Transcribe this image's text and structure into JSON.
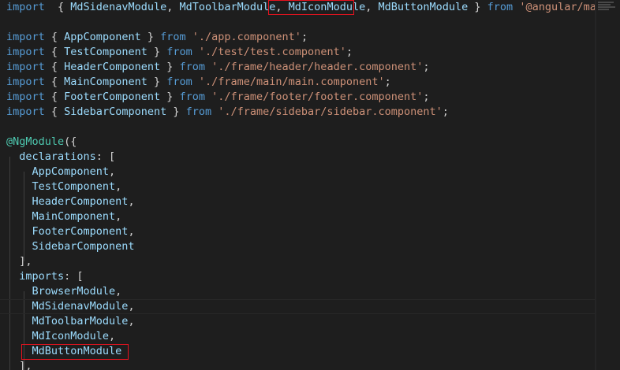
{
  "editor": {
    "lines": [
      {
        "tokens": [
          {
            "t": "import",
            "c": "kw"
          },
          {
            "t": "  { ",
            "c": "punc"
          },
          {
            "t": "MdSidenavModule",
            "c": "ident"
          },
          {
            "t": ", ",
            "c": "punc"
          },
          {
            "t": "MdToolbarModule",
            "c": "ident"
          },
          {
            "t": ", ",
            "c": "punc"
          },
          {
            "t": "MdIconModule",
            "c": "ident"
          },
          {
            "t": ", ",
            "c": "punc"
          },
          {
            "t": "MdButtonModule",
            "c": "ident"
          },
          {
            "t": " } ",
            "c": "punc"
          },
          {
            "t": "from",
            "c": "kw"
          },
          {
            "t": " ",
            "c": "punc"
          },
          {
            "t": "'@angular/materia",
            "c": "str"
          }
        ]
      },
      {
        "tokens": []
      },
      {
        "tokens": [
          {
            "t": "import",
            "c": "kw"
          },
          {
            "t": " { ",
            "c": "punc"
          },
          {
            "t": "AppComponent",
            "c": "ident"
          },
          {
            "t": " } ",
            "c": "punc"
          },
          {
            "t": "from",
            "c": "kw"
          },
          {
            "t": " ",
            "c": "punc"
          },
          {
            "t": "'./app.component'",
            "c": "str"
          },
          {
            "t": ";",
            "c": "punc"
          }
        ]
      },
      {
        "tokens": [
          {
            "t": "import",
            "c": "kw"
          },
          {
            "t": " { ",
            "c": "punc"
          },
          {
            "t": "TestComponent",
            "c": "ident"
          },
          {
            "t": " } ",
            "c": "punc"
          },
          {
            "t": "from",
            "c": "kw"
          },
          {
            "t": " ",
            "c": "punc"
          },
          {
            "t": "'./test/test.component'",
            "c": "str"
          },
          {
            "t": ";",
            "c": "punc"
          }
        ]
      },
      {
        "tokens": [
          {
            "t": "import",
            "c": "kw"
          },
          {
            "t": " { ",
            "c": "punc"
          },
          {
            "t": "HeaderComponent",
            "c": "ident"
          },
          {
            "t": " } ",
            "c": "punc"
          },
          {
            "t": "from",
            "c": "kw"
          },
          {
            "t": " ",
            "c": "punc"
          },
          {
            "t": "'./frame/header/header.component'",
            "c": "str"
          },
          {
            "t": ";",
            "c": "punc"
          }
        ]
      },
      {
        "tokens": [
          {
            "t": "import",
            "c": "kw"
          },
          {
            "t": " { ",
            "c": "punc"
          },
          {
            "t": "MainComponent",
            "c": "ident"
          },
          {
            "t": " } ",
            "c": "punc"
          },
          {
            "t": "from",
            "c": "kw"
          },
          {
            "t": " ",
            "c": "punc"
          },
          {
            "t": "'./frame/main/main.component'",
            "c": "str"
          },
          {
            "t": ";",
            "c": "punc"
          }
        ]
      },
      {
        "tokens": [
          {
            "t": "import",
            "c": "kw"
          },
          {
            "t": " { ",
            "c": "punc"
          },
          {
            "t": "FooterComponent",
            "c": "ident"
          },
          {
            "t": " } ",
            "c": "punc"
          },
          {
            "t": "from",
            "c": "kw"
          },
          {
            "t": " ",
            "c": "punc"
          },
          {
            "t": "'./frame/footer/footer.component'",
            "c": "str"
          },
          {
            "t": ";",
            "c": "punc"
          }
        ]
      },
      {
        "tokens": [
          {
            "t": "import",
            "c": "kw"
          },
          {
            "t": " { ",
            "c": "punc"
          },
          {
            "t": "SidebarComponent",
            "c": "ident"
          },
          {
            "t": " } ",
            "c": "punc"
          },
          {
            "t": "from",
            "c": "kw"
          },
          {
            "t": " ",
            "c": "punc"
          },
          {
            "t": "'./frame/sidebar/sidebar.component'",
            "c": "str"
          },
          {
            "t": ";",
            "c": "punc"
          }
        ]
      },
      {
        "tokens": []
      },
      {
        "tokens": [
          {
            "t": "@NgModule",
            "c": "deco"
          },
          {
            "t": "({",
            "c": "punc"
          }
        ]
      },
      {
        "tokens": [
          {
            "t": "  declarations",
            "c": "ident"
          },
          {
            "t": ": [",
            "c": "punc"
          }
        ]
      },
      {
        "tokens": [
          {
            "t": "    AppComponent",
            "c": "ident"
          },
          {
            "t": ",",
            "c": "punc"
          }
        ]
      },
      {
        "tokens": [
          {
            "t": "    TestComponent",
            "c": "ident"
          },
          {
            "t": ",",
            "c": "punc"
          }
        ]
      },
      {
        "tokens": [
          {
            "t": "    HeaderComponent",
            "c": "ident"
          },
          {
            "t": ",",
            "c": "punc"
          }
        ]
      },
      {
        "tokens": [
          {
            "t": "    MainComponent",
            "c": "ident"
          },
          {
            "t": ",",
            "c": "punc"
          }
        ]
      },
      {
        "tokens": [
          {
            "t": "    FooterComponent",
            "c": "ident"
          },
          {
            "t": ",",
            "c": "punc"
          }
        ]
      },
      {
        "tokens": [
          {
            "t": "    SidebarComponent",
            "c": "ident"
          }
        ]
      },
      {
        "tokens": [
          {
            "t": "  ],",
            "c": "punc"
          }
        ]
      },
      {
        "tokens": [
          {
            "t": "  imports",
            "c": "ident"
          },
          {
            "t": ": [",
            "c": "punc"
          }
        ]
      },
      {
        "tokens": [
          {
            "t": "    BrowserModule",
            "c": "ident"
          },
          {
            "t": ",",
            "c": "punc"
          }
        ]
      },
      {
        "tokens": [
          {
            "t": "    MdSidenavModule",
            "c": "ident"
          },
          {
            "t": ",",
            "c": "punc"
          }
        ]
      },
      {
        "tokens": [
          {
            "t": "    MdToolbarModule",
            "c": "ident"
          },
          {
            "t": ",",
            "c": "punc"
          }
        ]
      },
      {
        "tokens": [
          {
            "t": "    MdIconModule",
            "c": "ident"
          },
          {
            "t": ",",
            "c": "punc"
          }
        ]
      },
      {
        "tokens": [
          {
            "t": "    MdButtonModule",
            "c": "ident"
          }
        ]
      },
      {
        "tokens": [
          {
            "t": "  ],",
            "c": "punc"
          }
        ]
      }
    ],
    "colors": {
      "background": "#1e1e1e",
      "keyword": "#569cd6",
      "identifier": "#9cdcfe",
      "string": "#ce9178",
      "punctuation": "#d4d4d4",
      "decorator": "#4ec9b0",
      "highlight_box": "#e8131f"
    }
  }
}
